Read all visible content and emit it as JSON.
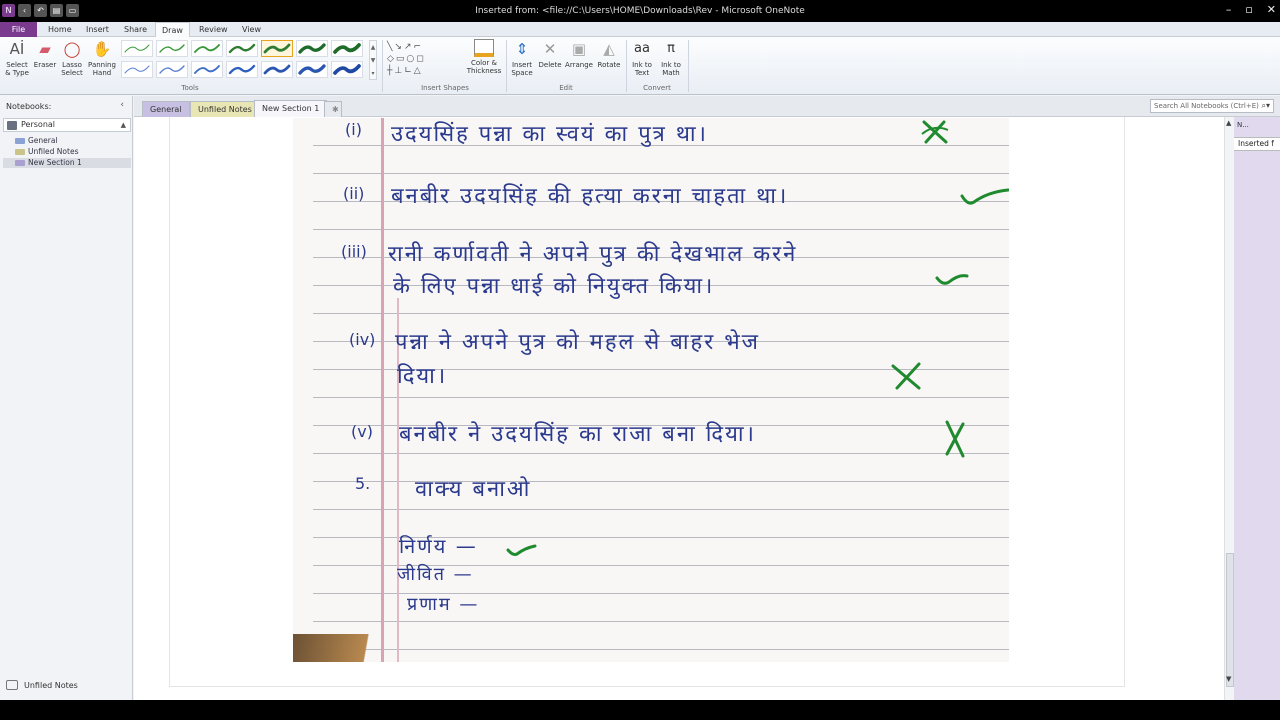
{
  "window": {
    "title": "Inserted from: <file://C:\\Users\\HOME\\Downloads\\Rev - Microsoft OneNote"
  },
  "ribbon_tabs": [
    {
      "label": "File"
    },
    {
      "label": "Home"
    },
    {
      "label": "Insert"
    },
    {
      "label": "Share"
    },
    {
      "label": "Draw"
    },
    {
      "label": "Review"
    },
    {
      "label": "View"
    }
  ],
  "ribbon": {
    "select_type": "Select & Type",
    "eraser": "Eraser",
    "lasso": "Lasso Select",
    "panning": "Panning Hand",
    "tools_group": "Tools",
    "color_thickness": "Color & Thickness",
    "insert_shapes_group": "Insert Shapes",
    "insert_space": "Insert Space",
    "delete": "Delete",
    "arrange": "Arrange",
    "rotate": "Rotate",
    "edit_group": "Edit",
    "ink_to_text": "Ink to Text",
    "ink_to_math": "Ink to Math",
    "convert_group": "Convert",
    "pen_colors": [
      "#3a9a3a",
      "#3a9a3a",
      "#3a9a3a",
      "#2e7d32",
      "#2e7d32",
      "#1f6b2a",
      "#1f6b2a",
      "#5b7fd0",
      "#5b7fd0",
      "#3e6fc9",
      "#2f5fbf",
      "#2a55b0",
      "#2a55b0",
      "#1e4aa6"
    ]
  },
  "nav": {
    "heading": "Notebooks:",
    "notebook": "Personal",
    "sections": [
      {
        "label": "General",
        "color": "#8aa2d6"
      },
      {
        "label": "Unfiled Notes",
        "color": "#c9c48a"
      },
      {
        "label": "New Section 1",
        "color": "#a9a0cf"
      }
    ],
    "bottom_label": "Unfiled Notes"
  },
  "section_tabs": [
    {
      "label": "General",
      "color": "#c7c0e2"
    },
    {
      "label": "Unfiled Notes",
      "color": "#e8e6b5"
    },
    {
      "label": "New Section 1",
      "color": "#f3f1f8"
    }
  ],
  "search": {
    "placeholder": "Search All Notebooks (Ctrl+E)"
  },
  "page_pane": {
    "new_page": "N...",
    "page_title": "Inserted f"
  },
  "notebook_text": {
    "l1_num": "(i)",
    "l1": "उदयसिंह पन्ना का स्वयं का पुत्र था।",
    "l2_num": "(ii)",
    "l2": "बनबीर उदयसिंह की हत्या करना चाहता था।",
    "l3_num": "(iii)",
    "l3a": "रानी कर्णावती ने अपने पुत्र की देखभाल करने",
    "l3b": "के लिए पन्ना धाई को नियुक्त किया।",
    "l4_num": "(iv)",
    "l4a": "पन्ना ने अपने पुत्र को महल से बाहर भेज",
    "l4b": "दिया।",
    "l5_num": "(v)",
    "l5": "बनबीर ने उदयसिंह का राजा बना दिया।",
    "q5_num": "5.",
    "q5": "वाक्य बनाओ",
    "w1": "निर्णय —",
    "w2": "जीवित —",
    "w3": "प्रणाम —"
  }
}
